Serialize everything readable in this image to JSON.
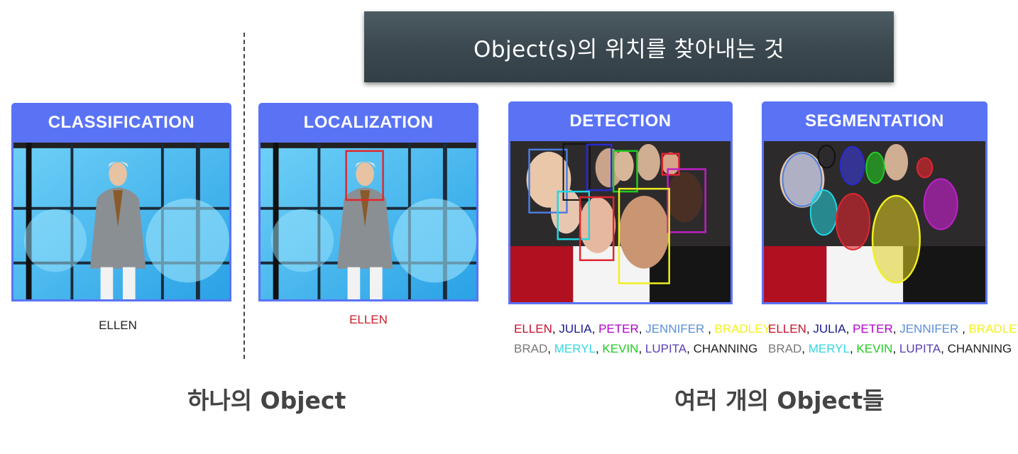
{
  "banner": {
    "title": "Object(s)의 위치를 찾아내는 것"
  },
  "panels": [
    {
      "title": "CLASSIFICATION",
      "caption": "ELLEN"
    },
    {
      "title": "LOCALIZATION",
      "caption": "ELLEN"
    },
    {
      "title": "DETECTION"
    },
    {
      "title": "SEGMENTATION"
    }
  ],
  "names_line1": [
    {
      "text": "ELLEN",
      "color": "#c8102e"
    },
    {
      "text": "JULIA",
      "color": "#1a1a8c"
    },
    {
      "text": "PETER",
      "color": "#b000c8"
    },
    {
      "text": "JENNIFER",
      "color": "#5b8fd6"
    },
    {
      "text": "BRADLEY,",
      "color": "#f2f020"
    }
  ],
  "names_line2": [
    {
      "text": "BRAD",
      "color": "#777777"
    },
    {
      "text": "MERYL",
      "color": "#33d6e0"
    },
    {
      "text": "KEVIN",
      "color": "#22cc22"
    },
    {
      "text": "LUPITA",
      "color": "#5b3fb0"
    },
    {
      "text": "CHANNING",
      "color": "#222222"
    }
  ],
  "footer": {
    "single": "하나의 Object",
    "multiple": "여러 개의 Object들"
  }
}
